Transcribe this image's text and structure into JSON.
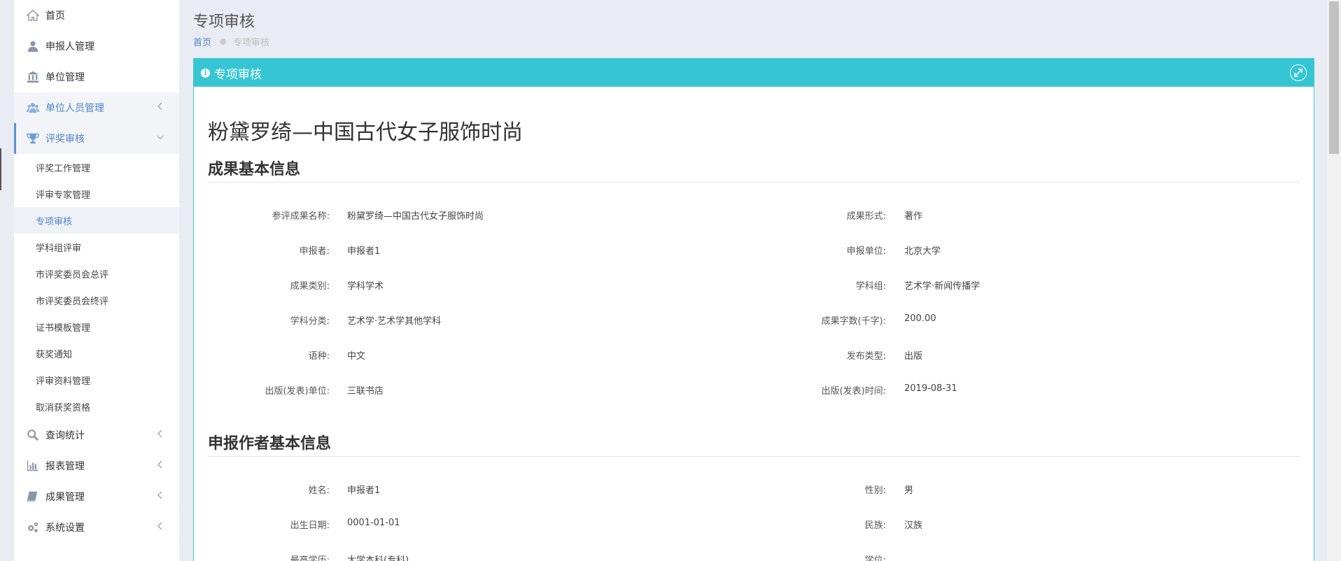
{
  "sidebar": {
    "items": [
      {
        "label": "首页",
        "icon": "home-icon"
      },
      {
        "label": "申报人管理",
        "icon": "user-icon"
      },
      {
        "label": "单位管理",
        "icon": "bank-icon"
      },
      {
        "label": "单位人员管理",
        "icon": "users-icon"
      },
      {
        "label": "评奖审核",
        "icon": "trophy-icon"
      }
    ],
    "sub_items": [
      "评奖工作管理",
      "评审专家管理",
      "专项审核",
      "学科组评审",
      "市评奖委员会总评",
      "市评奖委员会终评",
      "证书模板管理",
      "获奖通知",
      "评审资料管理",
      "取消获奖资格"
    ],
    "bottom_items": [
      {
        "label": "查询统计",
        "icon": "search-icon"
      },
      {
        "label": "报表管理",
        "icon": "bar-chart-icon"
      },
      {
        "label": "成果管理",
        "icon": "book-icon"
      },
      {
        "label": "系统设置",
        "icon": "cogs-icon"
      }
    ]
  },
  "page": {
    "title": "专项审核",
    "breadcrumb": {
      "home": "首页",
      "current": "专项审核"
    }
  },
  "panel": {
    "title": "专项审核",
    "work_title": "粉黛罗绮—中国古代女子服饰时尚",
    "section1": "成果基本信息",
    "section2": "申报作者基本信息",
    "basic_info": [
      {
        "l1": "参评成果名称:",
        "v1": "粉黛罗绮—中国古代女子服饰时尚",
        "l2": "成果形式:",
        "v2": "著作"
      },
      {
        "l1": "申报者:",
        "v1": "申报者1",
        "l2": "申报单位:",
        "v2": "北京大学"
      },
      {
        "l1": "成果类别:",
        "v1": "学科学术",
        "l2": "学科组:",
        "v2": "艺术学·新闻传播学"
      },
      {
        "l1": "学科分类:",
        "v1": "艺术学·艺术学其他学科",
        "l2": "成果字数(千字):",
        "v2": "200.00"
      },
      {
        "l1": "语种:",
        "v1": "中文",
        "l2": "发布类型:",
        "v2": "出版"
      },
      {
        "l1": "出版(发表)单位:",
        "v1": "三联书店",
        "l2": "出版(发表)时间:",
        "v2": "2019-08-31"
      }
    ],
    "author_info": [
      {
        "l1": "姓名:",
        "v1": "申报者1",
        "l2": "性别:",
        "v2": "男"
      },
      {
        "l1": "出生日期:",
        "v1": "0001-01-01",
        "l2": "民族:",
        "v2": "汉族"
      },
      {
        "l1": "最高学历:",
        "v1": "大学本科(专科)",
        "l2": "学位:",
        "v2": ""
      }
    ]
  },
  "colors": {
    "accent": "#36c6d3",
    "link": "#4f86c6"
  }
}
